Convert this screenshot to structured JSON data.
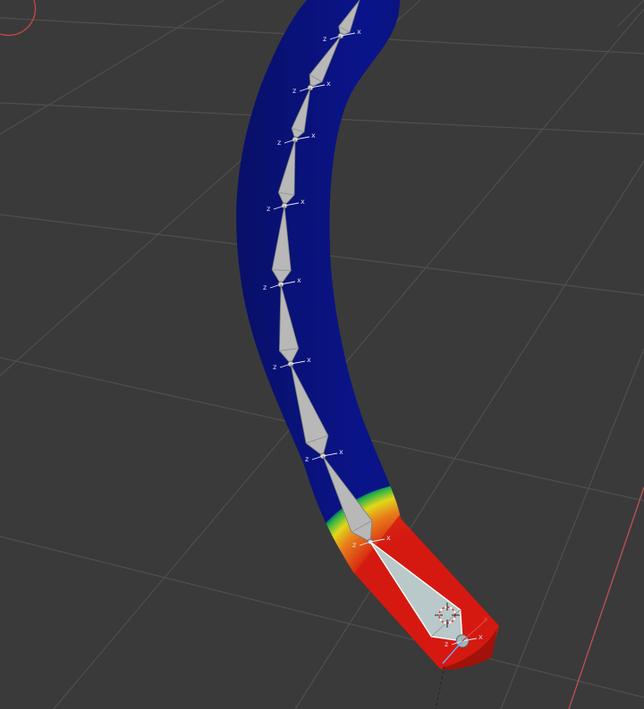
{
  "viewport": {
    "mode": "Weight Paint",
    "background": "#3a3a3a",
    "grid_color": "#555555"
  },
  "bones": {
    "count": 12,
    "color": "#b8b8b8",
    "active_color": "#b9c8c8",
    "active_bone_index": 11,
    "axis_x_label": "x",
    "axis_z_label": "z"
  },
  "weight_gradient": {
    "low_color": "#0a0f7a",
    "high_color": "#e01a0e",
    "mid_colors": [
      "#1fb04a",
      "#e0d81a",
      "#e8801a"
    ]
  },
  "gizmo": {
    "cursor_icon": "3d-cursor-icon",
    "x_axis_color": "#e04040",
    "y_axis_color": "#80a0ff"
  }
}
